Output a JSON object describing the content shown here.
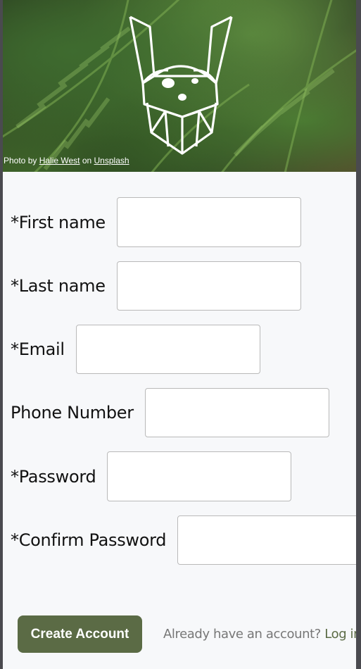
{
  "hero": {
    "credit_prefix": "Photo by ",
    "photographer": "Halie West",
    "credit_middle": " on ",
    "source": "Unsplash",
    "logo_icon": "viking-head-logo-icon"
  },
  "form": {
    "fields": [
      {
        "label": "*First name",
        "value": ""
      },
      {
        "label": "*Last name",
        "value": ""
      },
      {
        "label": "*Email",
        "value": ""
      },
      {
        "label": "Phone Number",
        "value": ""
      },
      {
        "label": "*Password",
        "value": ""
      },
      {
        "label": "*Confirm Password",
        "value": ""
      }
    ],
    "submit_label": "Create Account",
    "login_prompt": "Already have an account?",
    "login_link": "Log in"
  },
  "colors": {
    "accent": "#5b6b45",
    "page_background": "#f7f8fa",
    "link_muted": "#777777"
  }
}
